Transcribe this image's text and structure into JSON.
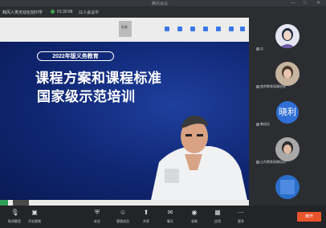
{
  "window": {
    "title": "腾讯会议"
  },
  "infobar": {
    "meeting_title": "韩风人类天动化刻印学",
    "duration": "01:30:58",
    "viewers": "11人会议中"
  },
  "slide": {
    "pill": "2022年版义务教育",
    "heading_line1": "课程方案和课程标准",
    "heading_line2": "国家级示范培训"
  },
  "toolbar_center": "标准",
  "sidebar": {
    "participants": [
      {
        "label": "议",
        "kind": "photo"
      },
      {
        "label": "曲师教育高端进修",
        "kind": "photo"
      },
      {
        "label": "教研员",
        "kind": "initial",
        "initial": "晓利"
      },
      {
        "label": "山东教育高端培训",
        "kind": "photo"
      },
      {
        "label": "",
        "kind": "photo"
      }
    ]
  },
  "bottombar": [
    {
      "icon": "mic-icon",
      "label": "取消静音"
    },
    {
      "icon": "camera-icon",
      "label": "开启视频"
    },
    {
      "icon": "security-icon",
      "label": "安全"
    },
    {
      "icon": "participants-icon",
      "label": "管理成员"
    },
    {
      "icon": "share-icon",
      "label": "共享"
    },
    {
      "icon": "chat-icon",
      "label": "聊天"
    },
    {
      "icon": "record-icon",
      "label": "录制"
    },
    {
      "icon": "apps-icon",
      "label": "应用"
    },
    {
      "icon": "more-icon",
      "label": "更多"
    }
  ],
  "exit_label": "离开"
}
